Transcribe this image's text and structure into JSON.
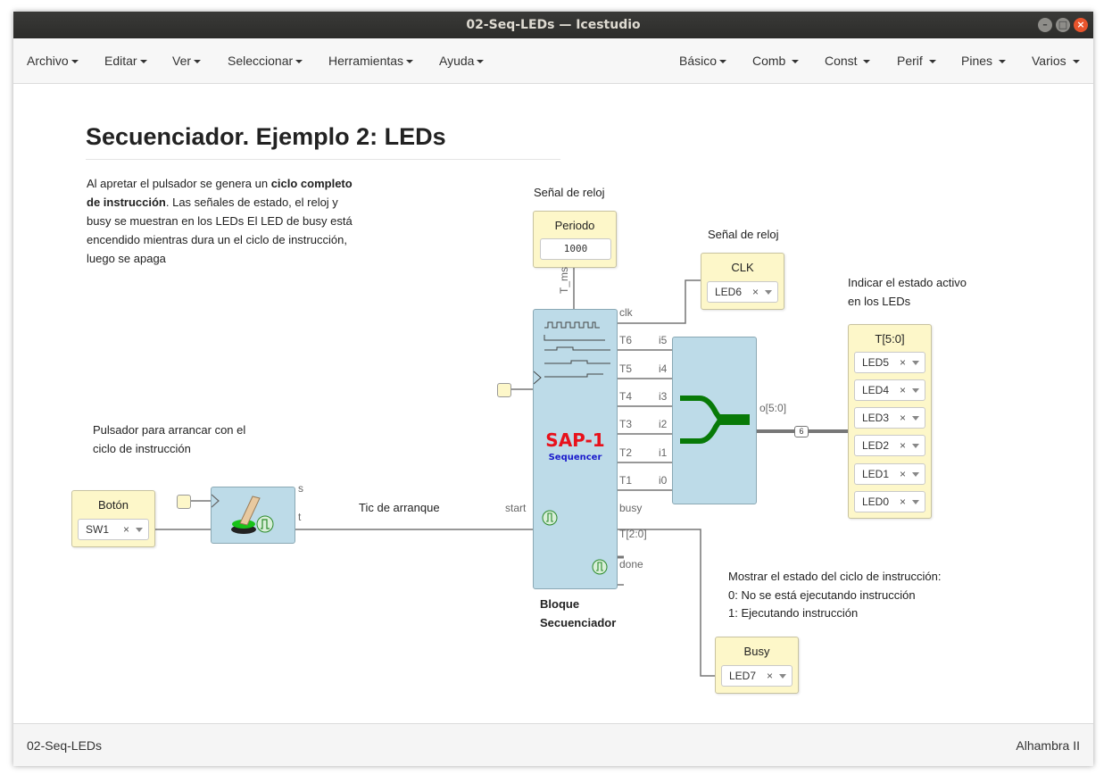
{
  "window": {
    "title": "02-Seq-LEDs — Icestudio"
  },
  "menu_left": [
    "Archivo",
    "Editar",
    "Ver",
    "Seleccionar",
    "Herramientas",
    "Ayuda"
  ],
  "menu_right": [
    "Básico",
    "Comb",
    "Const",
    "Perif",
    "Pines",
    "Varios"
  ],
  "heading": "Secuenciador. Ejemplo 2: LEDs",
  "description": {
    "p1": "Al apretar el pulsador se genera un ",
    "b1": "ciclo completo de instrucción",
    "p2": ". Las señales de estado, el reloj y busy se muestran en los LEDs El LED de busy está encendido mientras dura un el ciclo de instrucción, luego se apaga"
  },
  "notes": {
    "clock_signal_1": "Señal de reloj",
    "clock_signal_2": "Señal de reloj",
    "indicate_1": "Indicar el estado activo",
    "indicate_2": "en los LEDs",
    "button_1": "Pulsador para arrancar con el",
    "button_2": "ciclo de instrucción",
    "start_tick": "Tic de arranque",
    "show_1": "Mostrar el estado del ciclo de instrucción:",
    "show_2": "0: No se está ejecutando instrucción",
    "show_3": "1: Ejecutando instrucción",
    "block_1": "Bloque",
    "block_2": "Secuenciador"
  },
  "periodo": {
    "title": "Periodo",
    "value": "1000",
    "pin": "T_ms"
  },
  "clk_block": {
    "title": "CLK",
    "value": "LED6"
  },
  "boton": {
    "title": "Botón",
    "value": "SW1"
  },
  "busy_block": {
    "title": "Busy",
    "value": "LED7"
  },
  "t_block": {
    "title": "T[5:0]",
    "leds": [
      "LED5",
      "LED4",
      "LED3",
      "LED2",
      "LED1",
      "LED0"
    ]
  },
  "sap": {
    "title": "SAP-1",
    "subtitle": "Sequencer",
    "out_pins": [
      "clk",
      "T6",
      "T5",
      "T4",
      "T3",
      "T2",
      "T1",
      "busy",
      "T[2:0]",
      "done"
    ],
    "in_pin": "start"
  },
  "bus": {
    "in_pins": [
      "i5",
      "i4",
      "i3",
      "i2",
      "i1",
      "i0"
    ],
    "out_pin": "o[5:0]",
    "width": "6"
  },
  "button_block": {
    "pins": [
      "s",
      "t"
    ]
  },
  "remove_glyph": "×",
  "status": {
    "left": "02-Seq-LEDs",
    "right": "Alhambra II"
  },
  "colors": {
    "block_yellow": "#fdf7c9",
    "block_blue": "#bddbe8",
    "sap_red": "#e8111b",
    "sap_blue": "#1b1bcc",
    "bus_green": "#087a08",
    "titlebar": "#2e2e2c",
    "close_orange": "#e9542c"
  }
}
